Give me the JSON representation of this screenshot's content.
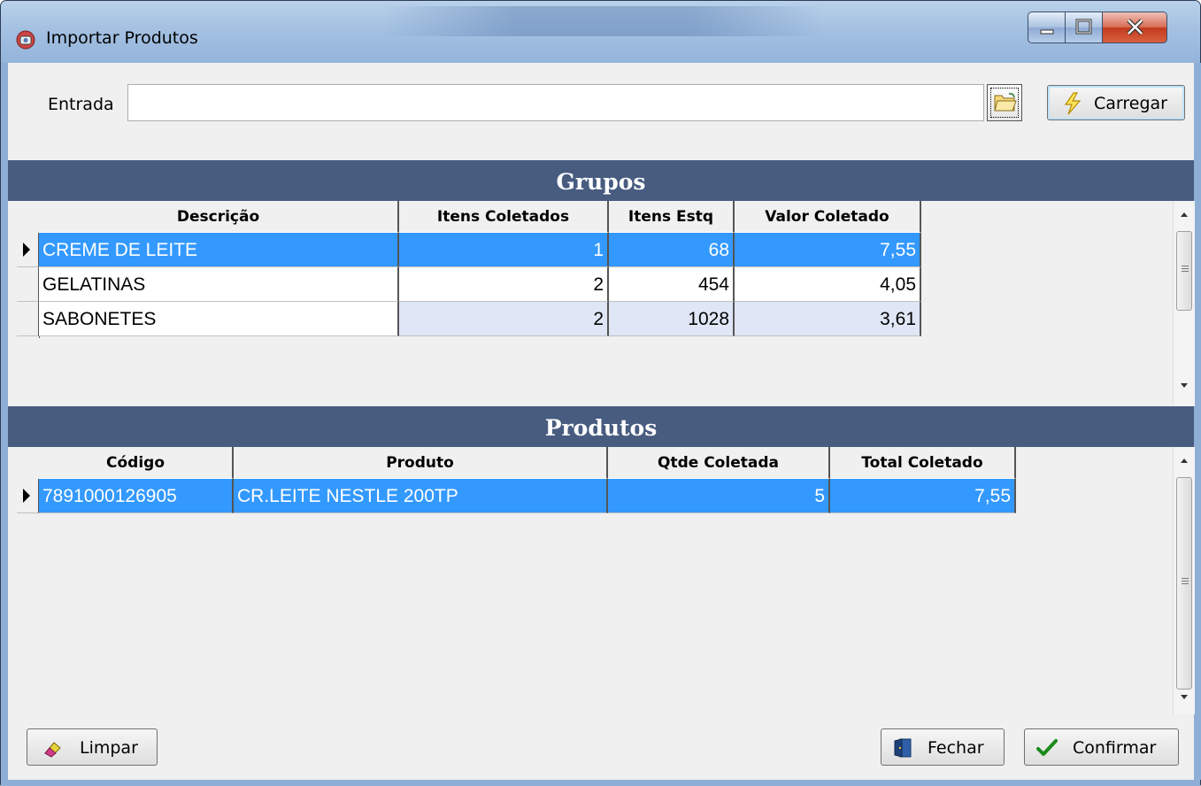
{
  "window": {
    "title": "Importar Produtos"
  },
  "entrada": {
    "label": "Entrada",
    "value": "",
    "browse_icon": "folder-open-icon"
  },
  "toolbar": {
    "carregar_label": "Carregar"
  },
  "grupos": {
    "title": "Grupos",
    "columns": [
      "Descrição",
      "Itens Coletados",
      "Itens Estq",
      "Valor Coletado"
    ],
    "rows": [
      {
        "descricao": "CREME DE LEITE",
        "itens_coletados": "1",
        "itens_estq": "68",
        "valor_coletado": "7,55"
      },
      {
        "descricao": "GELATINAS",
        "itens_coletados": "2",
        "itens_estq": "454",
        "valor_coletado": "4,05"
      },
      {
        "descricao": "SABONETES",
        "itens_coletados": "2",
        "itens_estq": "1028",
        "valor_coletado": "3,61"
      }
    ],
    "selected_row": 0
  },
  "produtos": {
    "title": "Produtos",
    "columns": [
      "Código",
      "Produto",
      "Qtde Coletada",
      "Total Coletado"
    ],
    "rows": [
      {
        "codigo": "7891000126905",
        "produto": "CR.LEITE NESTLE 200TP",
        "qtde": "5",
        "total": "7,55"
      }
    ],
    "selected_row": 0
  },
  "footer": {
    "limpar_label": "Limpar",
    "fechar_label": "Fechar",
    "confirmar_label": "Confirmar"
  },
  "colors": {
    "section_header": "#485c80",
    "selection": "#3399ff",
    "alt_row": "#dfe6f5"
  }
}
